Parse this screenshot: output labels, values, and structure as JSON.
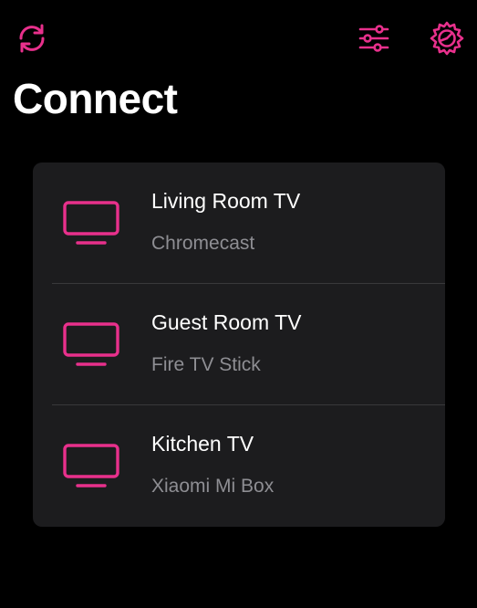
{
  "colors": {
    "accent": "#e8308c",
    "background": "#000000",
    "card": "#1c1c1e",
    "secondary_text": "#8e8e93",
    "divider": "#38383a"
  },
  "toolbar": {
    "refresh_icon": "refresh-icon",
    "filter_icon": "sliders-icon",
    "settings_icon": "gear-icon"
  },
  "header": {
    "title": "Connect"
  },
  "devices": [
    {
      "name": "Living Room TV",
      "type": "Chromecast",
      "icon": "tv-icon"
    },
    {
      "name": "Guest Room TV",
      "type": "Fire TV Stick",
      "icon": "tv-icon"
    },
    {
      "name": "Kitchen TV",
      "type": "Xiaomi Mi Box",
      "icon": "tv-icon"
    }
  ]
}
